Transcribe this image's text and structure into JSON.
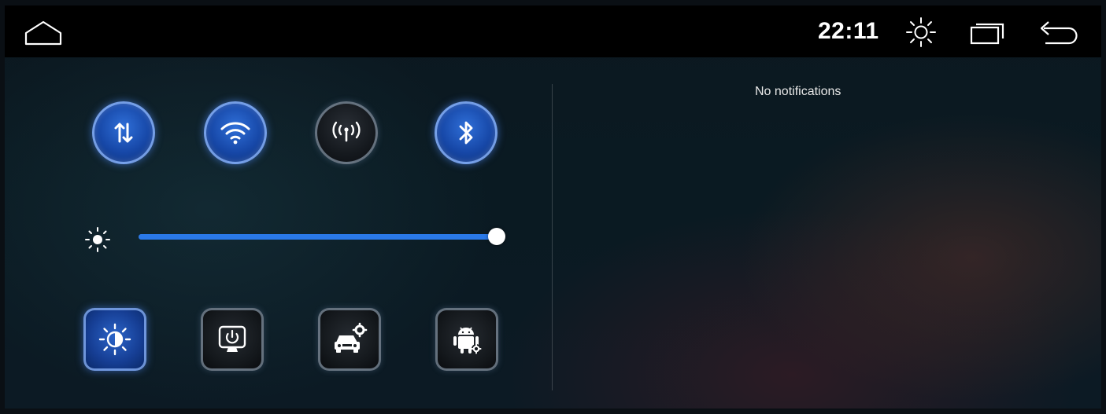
{
  "status_bar": {
    "clock": "22:11",
    "icons": [
      "home-icon",
      "brightness-icon",
      "recent-apps-icon",
      "back-icon"
    ]
  },
  "quick_toggles": [
    {
      "name": "mobile-data",
      "icon": "data-transfer-icon",
      "state": "on"
    },
    {
      "name": "wifi",
      "icon": "wifi-icon",
      "state": "on"
    },
    {
      "name": "hotspot",
      "icon": "hotspot-icon",
      "state": "off"
    },
    {
      "name": "bluetooth",
      "icon": "bluetooth-icon",
      "state": "on"
    }
  ],
  "brightness": {
    "icon": "brightness-low-icon",
    "level_fraction": 1.0
  },
  "shortcuts": [
    {
      "name": "display-mode",
      "icon": "contrast-brightness-icon",
      "state": "on"
    },
    {
      "name": "screen-off",
      "icon": "screen-power-icon",
      "state": "off"
    },
    {
      "name": "car-settings",
      "icon": "car-settings-icon",
      "state": "off"
    },
    {
      "name": "android-settings",
      "icon": "android-settings-icon",
      "state": "off"
    }
  ],
  "notifications": {
    "empty_text": "No notifications"
  },
  "colors": {
    "accent": "#2a79e8",
    "status_bar_bg": "#000000",
    "toggle_on": "#1748a8"
  }
}
